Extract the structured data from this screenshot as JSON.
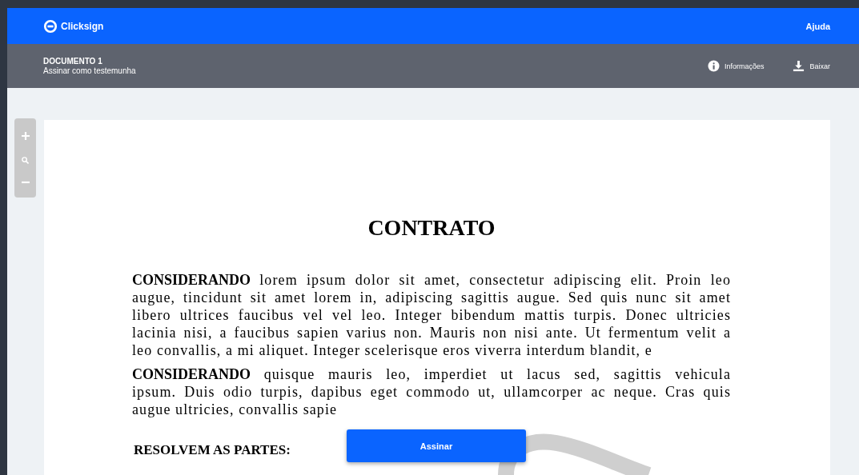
{
  "header": {
    "brand": "Clicksign",
    "help_link": "Ajuda"
  },
  "document_bar": {
    "title": "DOCUMENTO 1",
    "subtitle": "Assinar como testemunha",
    "actions": [
      {
        "kind": "info",
        "label": "Informações"
      },
      {
        "kind": "download",
        "label": "Baixar"
      }
    ]
  },
  "zoom_controls": [
    {
      "kind": "zoom-in"
    },
    {
      "kind": "search"
    },
    {
      "kind": "zoom-out"
    }
  ],
  "document": {
    "heading": "CONTRATO",
    "paragraphs": [
      {
        "lines": [
          "**CONSIDERANDO** lorem ipsum dolor sit amet, consectetur adipiscing elit. Proin leo",
          "augue, tincidunt sit amet lorem in, adipiscing sagittis augue. Sed quis nunc sit amet",
          "libero ultrices faucibus vel vel leo. Integer bibendum mattis turpis. Donec ultricies",
          "lacinia nisi, a faucibus sapien varius non. Mauris non nisi ante. Ut fermentum velit a",
          "leo convallis, a mi aliquet. Integer scelerisque eros viverra interdum blandit, e"
        ]
      },
      {
        "lines": [
          "**CONSIDERANDO** quisque mauris leo, imperdiet ut lacus sed, sagittis vehicula",
          "ipsum. Duis odio turpis, dapibus eget commodo ut, ullamcorper ac neque. Cras quis",
          "augue ultricies, convallis sapie"
        ]
      }
    ],
    "section_heading": "RESOLVEM AS PARTES:"
  },
  "sign_button": "Assinar"
}
